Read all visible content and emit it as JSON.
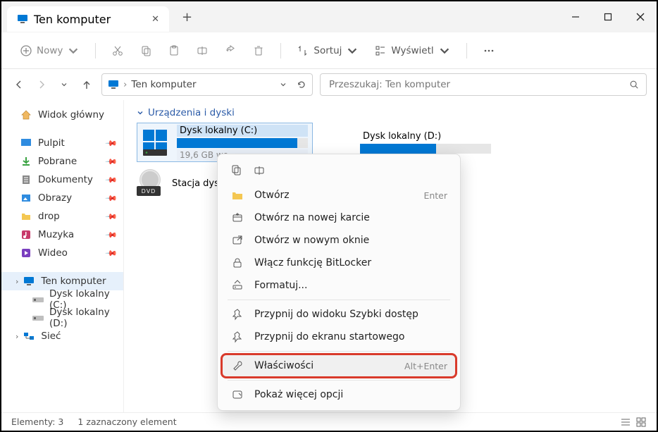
{
  "tab": {
    "title": "Ten komputer"
  },
  "toolbar": {
    "new": "Nowy",
    "sort": "Sortuj",
    "view": "Wyświetl"
  },
  "breadcrumb": {
    "location": "Ten komputer"
  },
  "search": {
    "placeholder": "Przeszukaj: Ten komputer"
  },
  "sidebar": {
    "home": "Widok główny",
    "items": [
      {
        "label": "Pulpit"
      },
      {
        "label": "Pobrane"
      },
      {
        "label": "Dokumenty"
      },
      {
        "label": "Obrazy"
      },
      {
        "label": "drop"
      },
      {
        "label": "Muzyka"
      },
      {
        "label": "Wideo"
      }
    ],
    "thispc": "Ten komputer",
    "drive_c": "Dysk lokalny (C:)",
    "drive_d": "Dysk lokalny (D:)",
    "network": "Sieć"
  },
  "group": {
    "header": "Urządzenia i dyski"
  },
  "drives": {
    "c": {
      "name": "Dysk lokalny (C:)",
      "sub": "19,6 GB wo",
      "fill_pct": 92
    },
    "d": {
      "name": "Dysk lokalny (D:)",
      "fill_pct": 58
    },
    "dvd": {
      "name": "Stacja dysk",
      "tray": "DVD"
    }
  },
  "ctx": {
    "open": "Otwórz",
    "open_hint": "Enter",
    "open_tab": "Otwórz na nowej karcie",
    "open_win": "Otwórz w nowym oknie",
    "bitlocker": "Włącz funkcję BitLocker",
    "format": "Formatuj...",
    "pin_quick": "Przypnij do widoku Szybki dostęp",
    "pin_start": "Przypnij do ekranu startowego",
    "props": "Właściwości",
    "props_hint": "Alt+Enter",
    "more": "Pokaż więcej opcji"
  },
  "status": {
    "count": "Elementy: 3",
    "sel": "1 zaznaczony element"
  }
}
